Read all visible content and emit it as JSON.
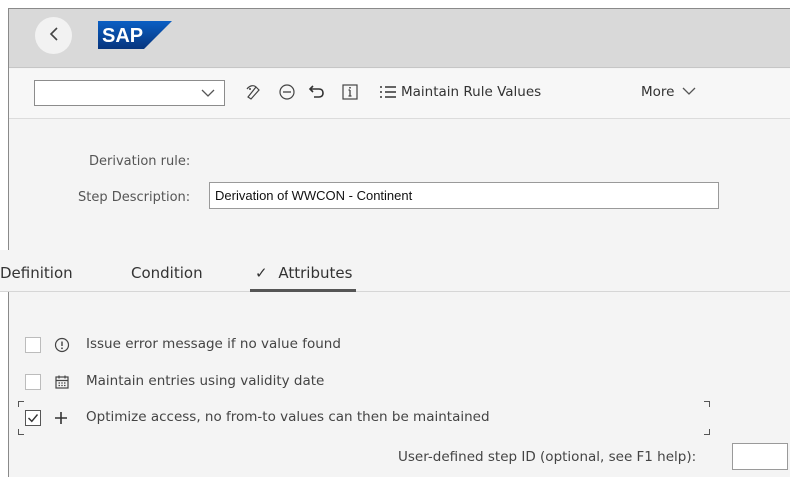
{
  "header": {
    "logo_text": "SAP",
    "back_icon": "chevron-left-icon"
  },
  "toolbar": {
    "select_value": "",
    "icons": [
      "display-change-icon",
      "minus-circle-icon",
      "undo-icon",
      "info-icon",
      "list-icon"
    ],
    "maintain_rule_values": "Maintain Rule Values",
    "more": "More"
  },
  "form": {
    "derivation_rule_label": "Derivation rule:",
    "step_description_label": "Step Description:",
    "step_description_value": "Derivation of WWCON - Continent"
  },
  "tabs": [
    {
      "label": "Definition"
    },
    {
      "label": "Condition"
    },
    {
      "label": "Attributes",
      "selected": true,
      "check": "✓"
    }
  ],
  "attributes": {
    "options": [
      {
        "label": "Issue error message if no value found",
        "checked": false,
        "icon": "alert-circle-icon"
      },
      {
        "label": "Maintain entries using validity date",
        "checked": false,
        "icon": "calendar-icon"
      },
      {
        "label": "Optimize access, no from-to values can then be maintained",
        "checked": true,
        "icon": "plus-icon"
      }
    ],
    "step_id_label": "User-defined step ID (optional, see F1 help):",
    "step_id_value": ""
  },
  "colors": {
    "shell_header": "#d9d9d9",
    "background": "#f4f4f4",
    "sap_blue": "#0a3e8c",
    "text": "#333333"
  }
}
